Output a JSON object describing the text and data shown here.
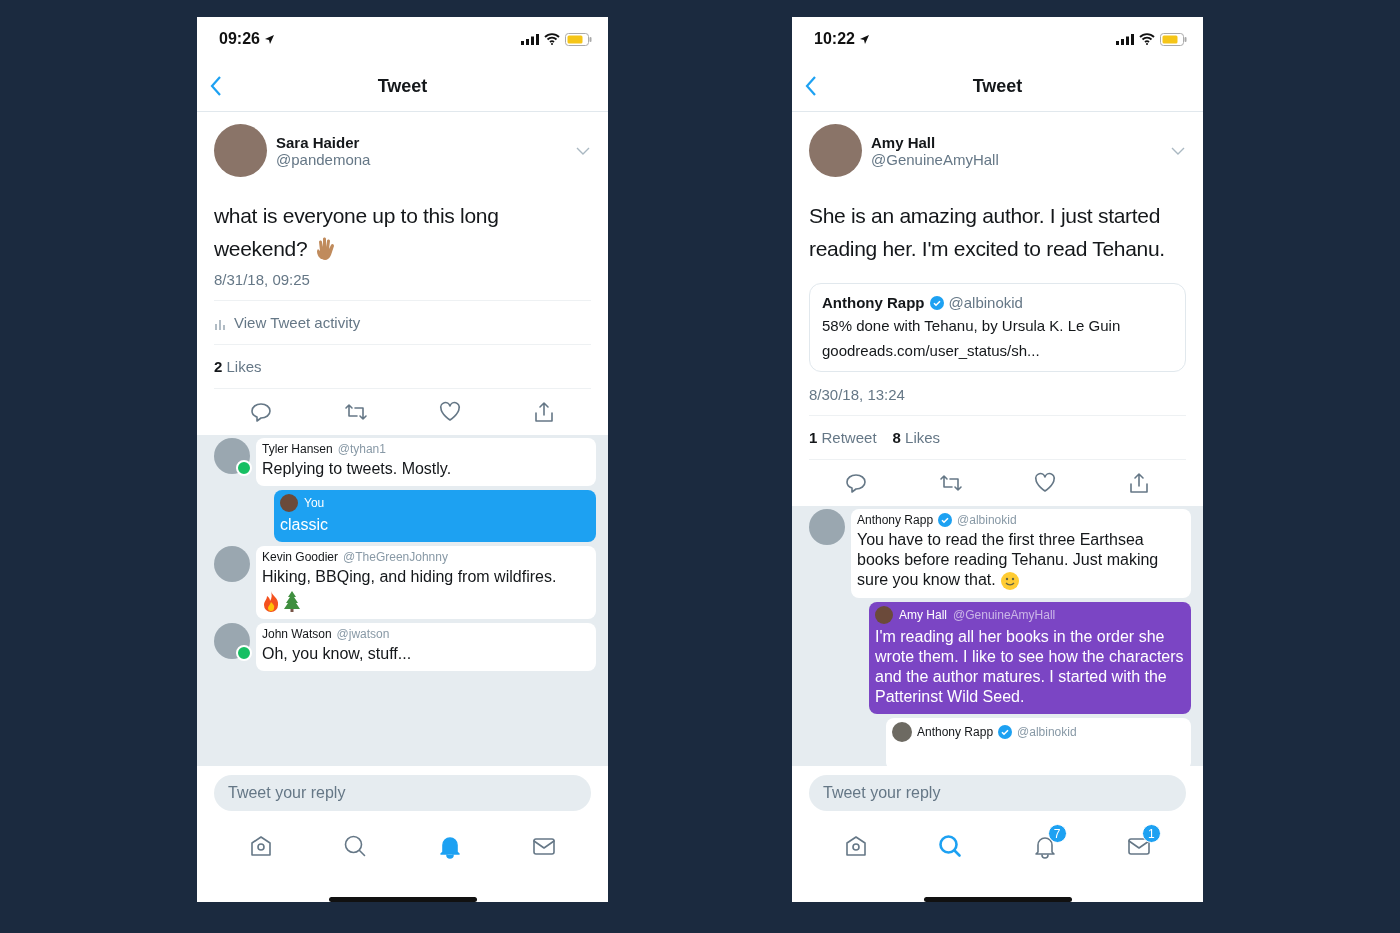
{
  "phones": [
    {
      "time": "09:26",
      "title": "Tweet",
      "tweet": {
        "name": "Sara Haider",
        "handle": "@pandemona",
        "text": "what is everyone up to this long weekend?",
        "waving_hand_emoji": true,
        "date": "8/31/18, 09:25",
        "activity": "View Tweet activity",
        "stats": [
          {
            "count": "2",
            "label": "Likes"
          }
        ]
      },
      "replies": [
        {
          "kind": "reply",
          "name": "Tyler Hansen",
          "handle": "@tyhan1",
          "online": true,
          "text": "Replying to tweets. Mostly."
        },
        {
          "kind": "own",
          "name": "You",
          "color": "#1da1f2",
          "text": "classic"
        },
        {
          "kind": "reply",
          "name": "Kevin Goodier",
          "handle": "@TheGreenJohnny",
          "online": false,
          "text": "Hiking, BBQing, and hiding from wildfires.",
          "fire_emoji": true,
          "tree_emoji": true
        },
        {
          "kind": "reply",
          "name": "John Watson",
          "handle": "@jwatson",
          "online": true,
          "text": "Oh, you know, stuff..."
        }
      ],
      "reply_placeholder": "Tweet your reply",
      "tabs": [
        {
          "kind": "home",
          "selected": false
        },
        {
          "kind": "search",
          "selected": false
        },
        {
          "kind": "notifications",
          "selected": true
        },
        {
          "kind": "messages",
          "selected": false
        }
      ]
    },
    {
      "time": "10:22",
      "title": "Tweet",
      "tweet": {
        "name": "Amy Hall",
        "handle": "@GenuineAmyHall",
        "text": "She is an amazing author. I just started reading her.  I'm excited to read Tehanu.",
        "date": "8/30/18, 13:24",
        "quote": {
          "name": "Anthony Rapp",
          "verified": true,
          "handle": "@albinokid",
          "text": "58% done with Tehanu, by Ursula K. Le Guin",
          "link": "goodreads.com/user_status/sh..."
        },
        "stats": [
          {
            "count": "1",
            "label": "Retweet"
          },
          {
            "count": "8",
            "label": "Likes"
          }
        ]
      },
      "replies": [
        {
          "kind": "reply",
          "name": "Anthony Rapp",
          "handle": "@albinokid",
          "verified": true,
          "online": false,
          "text": "You have to read the first three Earthsea books before reading Tehanu. Just making sure you know that.",
          "smiley_emoji": true
        },
        {
          "kind": "own",
          "name": "Amy Hall",
          "handle": "@GenuineAmyHall",
          "color": "#7b45c4",
          "text": "I'm reading all her books in the order she wrote them.  I like to see how the characters and the author matures.  I started with the Patterinst Wild Seed."
        },
        {
          "kind": "nested",
          "name": "Anthony Rapp",
          "handle": "@albinokid",
          "verified": true
        }
      ],
      "reply_placeholder": "Tweet your reply",
      "tabs": [
        {
          "kind": "home",
          "selected": false
        },
        {
          "kind": "search",
          "selected": true
        },
        {
          "kind": "notifications",
          "selected": false,
          "badge": "7"
        },
        {
          "kind": "messages",
          "selected": false,
          "badge": "1"
        }
      ]
    }
  ]
}
